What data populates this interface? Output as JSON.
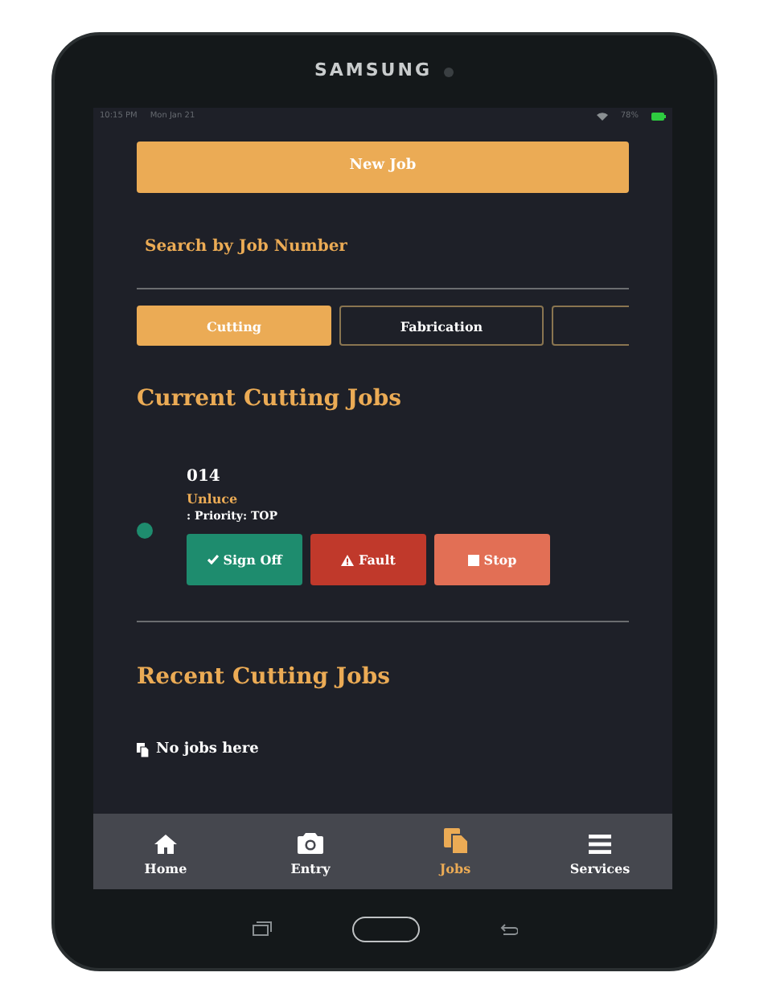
{
  "device": {
    "brand": "SAMSUNG"
  },
  "status_bar": {
    "time": "10:15 PM",
    "date": "Mon Jan 21",
    "battery": "78%"
  },
  "new_job_button": "New Job",
  "search_link": "Search by Job Number",
  "tabs": [
    {
      "label": "Cutting",
      "selected": true
    },
    {
      "label": "Fabrication",
      "selected": false
    },
    {
      "selected": false
    }
  ],
  "current_section": {
    "title": "Current Cutting Jobs",
    "jobs": [
      {
        "number": "014",
        "name": "Unluce",
        "priority": ": Priority: TOP",
        "color": "#1e8c6e",
        "actions": [
          {
            "kind": "signoff",
            "label": "Sign Off"
          },
          {
            "kind": "fault",
            "label": "Fault"
          },
          {
            "kind": "stop",
            "label": "Stop"
          }
        ]
      }
    ]
  },
  "recent_section": {
    "title": "Recent Cutting Jobs",
    "empty_text": "No jobs here"
  },
  "bottom_nav": [
    {
      "kind": "home",
      "label": "Home",
      "selected": false
    },
    {
      "kind": "camera",
      "label": "Entry",
      "selected": false
    },
    {
      "kind": "jobs",
      "label": "Jobs",
      "selected": true
    },
    {
      "kind": "menu",
      "label": "Services",
      "selected": false
    }
  ]
}
